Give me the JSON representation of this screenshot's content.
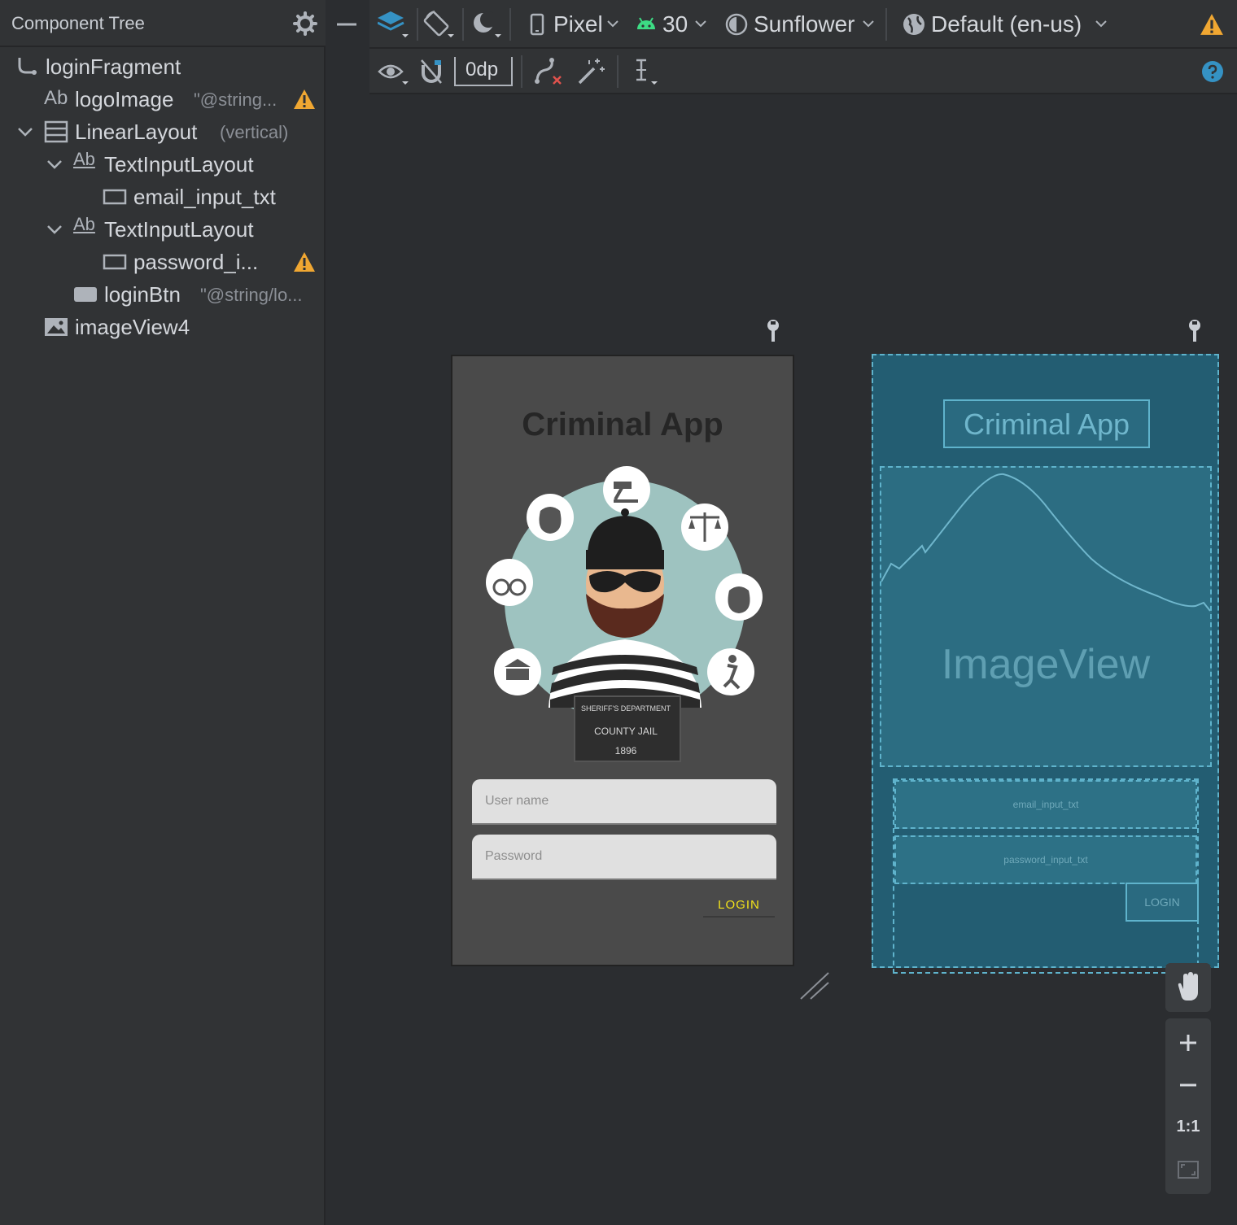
{
  "component_tree": {
    "title": "Component Tree",
    "nodes": [
      {
        "label": "loginFragment",
        "sub": "",
        "icon": "fragment-icon"
      },
      {
        "label": "logoImage",
        "sub": "\"@string...",
        "icon": "textview-icon",
        "warning": true
      },
      {
        "label": "LinearLayout",
        "sub": "(vertical)",
        "icon": "linearlayout-icon",
        "expanded": true
      },
      {
        "label": "TextInputLayout",
        "sub": "",
        "icon": "textview-icon",
        "expanded": true
      },
      {
        "label": "email_input_txt",
        "sub": "",
        "icon": "edittext-icon"
      },
      {
        "label": "TextInputLayout",
        "sub": "",
        "icon": "textview-icon",
        "expanded": true
      },
      {
        "label": "password_i...",
        "sub": "",
        "icon": "edittext-icon",
        "warning": true
      },
      {
        "label": "loginBtn",
        "sub": "\"@string/lo...",
        "icon": "button-icon"
      },
      {
        "label": "imageView4",
        "sub": "",
        "icon": "image-icon"
      }
    ],
    "ab_label": "Ab"
  },
  "toolbar": {
    "device": "Pixel",
    "api": "30",
    "theme": "Sunflower",
    "locale": "Default (en-us)",
    "margin": "0dp"
  },
  "design": {
    "title": "Criminal App",
    "username_hint": "User name",
    "password_hint": "Password",
    "login_label": "LOGIN",
    "sign_line1": "SHERIFF'S DEPARTMENT",
    "sign_line2": "COUNTY JAIL",
    "sign_line3": "1896"
  },
  "blueprint": {
    "title": "Criminal App",
    "image_label": "ImageView",
    "email_label": "email_input_txt",
    "password_label": "password_input_txt",
    "login_label": "LOGIN"
  },
  "zoom": {
    "one_to_one": "1:1"
  },
  "colors": {
    "accent_blue": "#3592c4",
    "warning": "#f0a732",
    "android_green": "#3ddc84",
    "blueprint": "#235d72",
    "login_text": "#f2e21a"
  }
}
